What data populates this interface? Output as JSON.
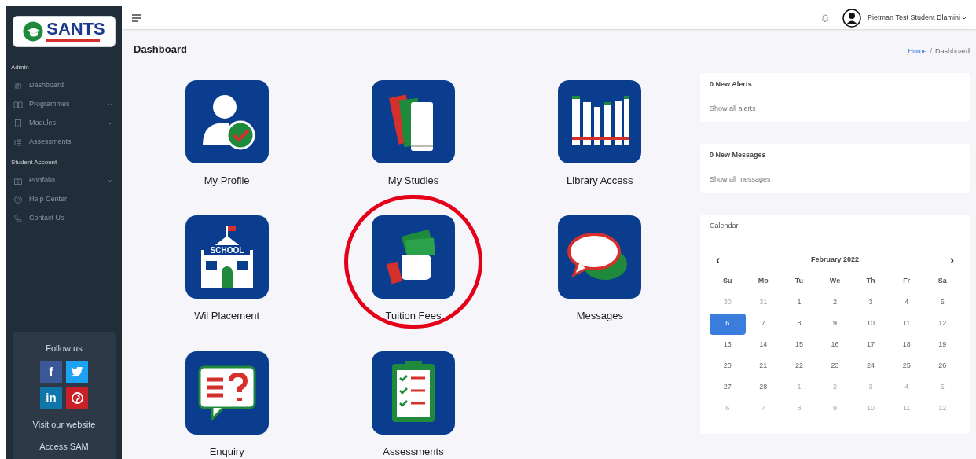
{
  "sidebar": {
    "logo": {
      "text": "SANTS"
    },
    "sections": [
      {
        "title": "Admin",
        "items": [
          {
            "label": "Dashboard",
            "kind": "sliders",
            "has_submenu": false
          },
          {
            "label": "Programmes",
            "kind": "book",
            "has_submenu": true
          },
          {
            "label": "Modules",
            "kind": "tablet",
            "has_submenu": true
          },
          {
            "label": "Assessments",
            "kind": "list",
            "has_submenu": false
          }
        ]
      },
      {
        "title": "Student Account",
        "items": [
          {
            "label": "Portfolio",
            "kind": "briefcase",
            "has_submenu": true
          },
          {
            "label": "Help Center",
            "kind": "help",
            "has_submenu": false
          },
          {
            "label": "Contact Us",
            "kind": "phone",
            "has_submenu": false
          }
        ]
      }
    ],
    "follow": {
      "title": "Follow us",
      "social": [
        {
          "kind": "facebook",
          "glyph": "f",
          "color": "#3b5998"
        },
        {
          "kind": "twitter",
          "color": "#1da1f2"
        },
        {
          "kind": "linkedin",
          "glyph": "in",
          "color": "#0e76a8"
        },
        {
          "kind": "pinterest",
          "color": "#cb2027"
        }
      ],
      "links": [
        "Visit our website",
        "Access SAM"
      ]
    }
  },
  "header": {
    "user_name": "Pietman Test Student Dlamini"
  },
  "page_title": "Dashboard",
  "breadcrumb": {
    "items": [
      "Home",
      "Dashboard"
    ],
    "separator": "/"
  },
  "tiles": [
    {
      "label": "My Profile",
      "kind": "profile",
      "highlighted": false
    },
    {
      "label": "My Studies",
      "kind": "books",
      "highlighted": false
    },
    {
      "label": "Library Access",
      "kind": "library",
      "highlighted": false
    },
    {
      "label": "Wil Placement",
      "kind": "school",
      "sign": "SCHOOL",
      "highlighted": false
    },
    {
      "label": "Tuition Fees",
      "kind": "money",
      "highlighted": true
    },
    {
      "label": "Messages",
      "kind": "chat",
      "highlighted": false
    },
    {
      "label": "Enquiry",
      "kind": "enquiry",
      "highlighted": false
    },
    {
      "label": "Assessments",
      "kind": "checklist",
      "highlighted": false
    }
  ],
  "alerts": {
    "title": "0 New Alerts",
    "link": "Show all alerts"
  },
  "messages": {
    "title": "0 New Messages",
    "link": "Show all messages"
  },
  "calendar": {
    "title": "Calendar",
    "prev": "‹",
    "next": "›",
    "month": "February 2022",
    "weekdays": [
      "Su",
      "Mo",
      "Tu",
      "We",
      "Th",
      "Fr",
      "Sa"
    ],
    "days": [
      {
        "label": "30",
        "muted": true,
        "selected": false
      },
      {
        "label": "31",
        "muted": true,
        "selected": false
      },
      {
        "label": "1",
        "muted": false,
        "selected": false
      },
      {
        "label": "2",
        "muted": false,
        "selected": false
      },
      {
        "label": "3",
        "muted": false,
        "selected": false
      },
      {
        "label": "4",
        "muted": false,
        "selected": false
      },
      {
        "label": "5",
        "muted": false,
        "selected": false
      },
      {
        "label": "6",
        "muted": false,
        "selected": true
      },
      {
        "label": "7",
        "muted": false,
        "selected": false
      },
      {
        "label": "8",
        "muted": false,
        "selected": false
      },
      {
        "label": "9",
        "muted": false,
        "selected": false
      },
      {
        "label": "10",
        "muted": false,
        "selected": false
      },
      {
        "label": "11",
        "muted": false,
        "selected": false
      },
      {
        "label": "12",
        "muted": false,
        "selected": false
      },
      {
        "label": "13",
        "muted": false,
        "selected": false
      },
      {
        "label": "14",
        "muted": false,
        "selected": false
      },
      {
        "label": "15",
        "muted": false,
        "selected": false
      },
      {
        "label": "16",
        "muted": false,
        "selected": false
      },
      {
        "label": "17",
        "muted": false,
        "selected": false
      },
      {
        "label": "18",
        "muted": false,
        "selected": false
      },
      {
        "label": "19",
        "muted": false,
        "selected": false
      },
      {
        "label": "20",
        "muted": false,
        "selected": false
      },
      {
        "label": "21",
        "muted": false,
        "selected": false
      },
      {
        "label": "22",
        "muted": false,
        "selected": false
      },
      {
        "label": "23",
        "muted": false,
        "selected": false
      },
      {
        "label": "24",
        "muted": false,
        "selected": false
      },
      {
        "label": "25",
        "muted": false,
        "selected": false
      },
      {
        "label": "26",
        "muted": false,
        "selected": false
      },
      {
        "label": "27",
        "muted": false,
        "selected": false
      },
      {
        "label": "28",
        "muted": false,
        "selected": false
      },
      {
        "label": "1",
        "muted": true,
        "selected": false
      },
      {
        "label": "2",
        "muted": true,
        "selected": false
      },
      {
        "label": "3",
        "muted": true,
        "selected": false
      },
      {
        "label": "4",
        "muted": true,
        "selected": false
      },
      {
        "label": "5",
        "muted": true,
        "selected": false
      },
      {
        "label": "6",
        "muted": true,
        "selected": false
      },
      {
        "label": "7",
        "muted": true,
        "selected": false
      },
      {
        "label": "8",
        "muted": true,
        "selected": false
      },
      {
        "label": "9",
        "muted": true,
        "selected": false
      },
      {
        "label": "10",
        "muted": true,
        "selected": false
      },
      {
        "label": "11",
        "muted": true,
        "selected": false
      },
      {
        "label": "12",
        "muted": true,
        "selected": false
      }
    ]
  }
}
